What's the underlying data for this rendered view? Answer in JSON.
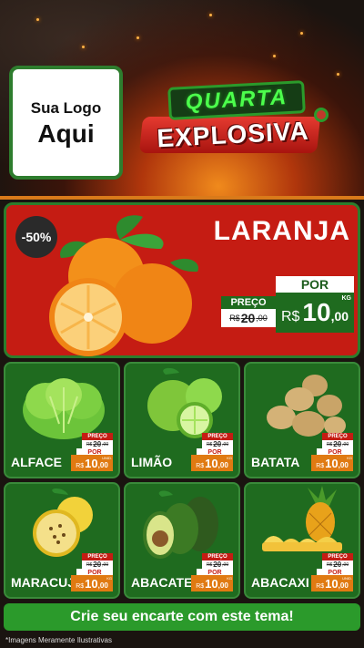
{
  "logo": {
    "line1": "Sua Logo",
    "line2": "Aqui"
  },
  "badge": {
    "top": "QUARTA",
    "bottom": "EXPLOSIVA"
  },
  "featured": {
    "discount": "-50%",
    "name": "LARANJA",
    "preco_label": "PREÇO",
    "old_prefix": "R$",
    "old_value": "20",
    "old_cents": ",00",
    "por_label": "POR",
    "currency": "R$",
    "value": "10",
    "cents": ",00",
    "unit": "KG"
  },
  "products": [
    {
      "name": "ALFACE",
      "preco_label": "PREÇO",
      "old_prefix": "R$",
      "old_value": "20",
      "old_cents": ",00",
      "por_label": "POR",
      "currency": "R$",
      "value": "10",
      "cents": ",00",
      "unit": "UNID."
    },
    {
      "name": "LIMÃO",
      "preco_label": "PREÇO",
      "old_prefix": "R$",
      "old_value": "20",
      "old_cents": ",00",
      "por_label": "POR",
      "currency": "R$",
      "value": "10",
      "cents": ",00",
      "unit": "KG"
    },
    {
      "name": "BATATA",
      "preco_label": "PREÇO",
      "old_prefix": "R$",
      "old_value": "20",
      "old_cents": ",00",
      "por_label": "POR",
      "currency": "R$",
      "value": "10",
      "cents": ",00",
      "unit": "KG"
    },
    {
      "name": "MARACUJÁ",
      "preco_label": "PREÇO",
      "old_prefix": "R$",
      "old_value": "20",
      "old_cents": ",00",
      "por_label": "POR",
      "currency": "R$",
      "value": "10",
      "cents": ",00",
      "unit": "KG"
    },
    {
      "name": "ABACATE",
      "preco_label": "PREÇO",
      "old_prefix": "R$",
      "old_value": "20",
      "old_cents": ",00",
      "por_label": "POR",
      "currency": "R$",
      "value": "10",
      "cents": ",00",
      "unit": "KG"
    },
    {
      "name": "ABACAXI",
      "preco_label": "PREÇO",
      "old_prefix": "R$",
      "old_value": "20",
      "old_cents": ",00",
      "por_label": "POR",
      "currency": "R$",
      "value": "10",
      "cents": ",00",
      "unit": "UNID."
    }
  ],
  "cta": "Crie seu encarte com este tema!",
  "footer": "*Imagens Meramente Ilustrativas",
  "colors": {
    "red": "#c51c13",
    "green": "#1f6b1f",
    "orange": "#e07a12",
    "accent_green": "#2b9a2b"
  }
}
